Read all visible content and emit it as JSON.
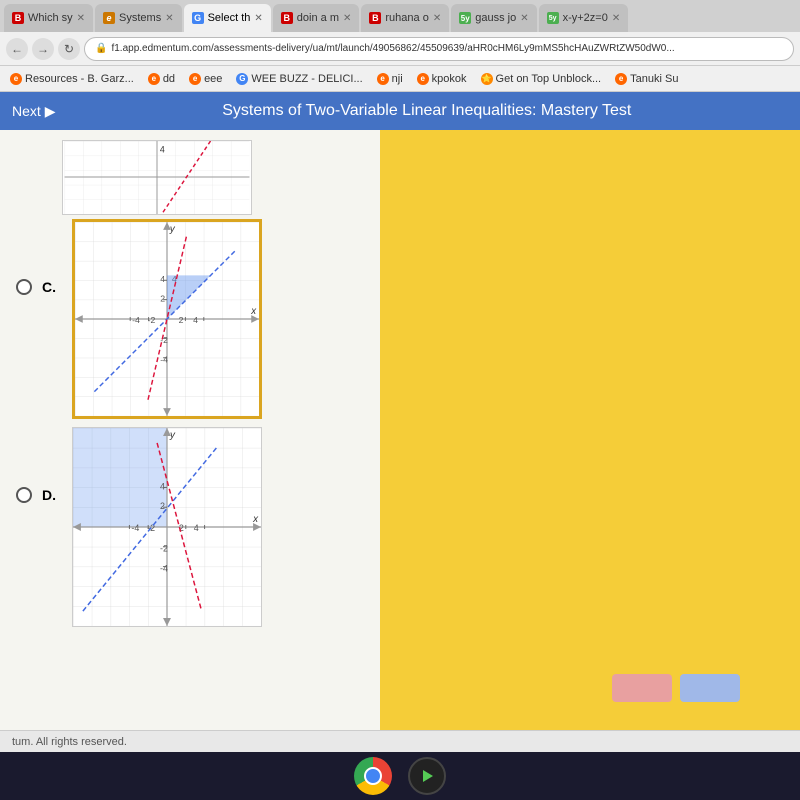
{
  "browser": {
    "tabs": [
      {
        "id": "tab1",
        "label": "Which sy",
        "icon_color": "#cc0000",
        "icon_text": "B",
        "active": false
      },
      {
        "id": "tab2",
        "label": "Systems",
        "icon_color": "#cc7700",
        "icon_text": "e",
        "active": false
      },
      {
        "id": "tab3",
        "label": "Select th",
        "icon_color": "#4285F4",
        "icon_text": "G",
        "active": true
      },
      {
        "id": "tab4",
        "label": "doin a m",
        "icon_color": "#cc0000",
        "icon_text": "B",
        "active": false
      },
      {
        "id": "tab5",
        "label": "ruhana o",
        "icon_color": "#cc0000",
        "icon_text": "B",
        "active": false
      },
      {
        "id": "tab6",
        "label": "gauss jo",
        "icon_color": "#4CAF50",
        "icon_text": "5y",
        "active": false
      },
      {
        "id": "tab7",
        "label": "x-y+2z=0",
        "icon_color": "#4CAF50",
        "icon_text": "5y",
        "active": false
      }
    ],
    "address": "f1.app.edmentum.com/assessments-delivery/ua/mt/launch/49056862/45509639/aHR0cHM6Ly9mMS5hcHAuZWRtZW50dW0...",
    "bookmarks": [
      {
        "label": "Resources - B. Garz...",
        "icon_color": "#ff6600"
      },
      {
        "label": "dd",
        "icon_color": "#ff6600"
      },
      {
        "label": "eee",
        "icon_color": "#ff6600"
      },
      {
        "label": "WEE BUZZ - DELICI...",
        "icon_color": "#4285F4"
      },
      {
        "label": "nji",
        "icon_color": "#ff6600"
      },
      {
        "label": "kpokok",
        "icon_color": "#ff6600"
      },
      {
        "label": "Get on Top Unblock...",
        "icon_color": "#ff8800"
      },
      {
        "label": "Tanuki Su",
        "icon_color": "#ff6600"
      }
    ]
  },
  "page": {
    "title": "Systems of Two-Variable Linear Inequalities: Mastery Test",
    "next_label": "Next",
    "options": [
      {
        "id": "C",
        "label": "C."
      },
      {
        "id": "D",
        "label": "D."
      }
    ]
  },
  "footer": {
    "text": "tum. All rights reserved."
  },
  "graph_c": {
    "shading_color": "rgba(100, 149, 237, 0.4)",
    "line1_color": "#4169E1",
    "line2_color": "#DC143C"
  },
  "graph_d": {
    "shading_color": "rgba(100, 149, 237, 0.3)",
    "line1_color": "#4169E1",
    "line2_color": "#DC143C"
  }
}
